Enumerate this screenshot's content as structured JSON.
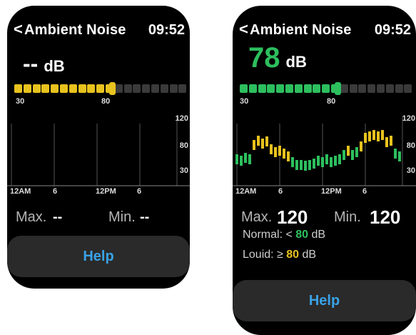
{
  "left": {
    "title": "Ambient Noise",
    "time": "09:52",
    "reading": "--",
    "unit": "dB",
    "bar_min": "30",
    "bar_mark": "80",
    "level_active": 0.57,
    "y_ticks": [
      "120",
      "80",
      "30"
    ],
    "x_ticks": [
      "12AM",
      "6",
      "12PM",
      "6"
    ],
    "max_label": "Max.",
    "max_value": "--",
    "min_label": "Min.",
    "min_value": "--",
    "help": "Help"
  },
  "right": {
    "title": "Ambient Noise",
    "time": "09:52",
    "reading": "78",
    "unit": "dB",
    "bar_min": "30",
    "bar_mark": "80",
    "level_active": 0.57,
    "y_ticks": [
      "120",
      "80",
      "30"
    ],
    "x_ticks": [
      "12AM",
      "6",
      "12PM",
      "6"
    ],
    "max_label": "Max.",
    "max_value": "120",
    "min_label": "Min.",
    "min_value": "120",
    "normal_label": "Normal:",
    "normal_sym": "<",
    "normal_val": "80",
    "loud_label": "Louid:",
    "loud_sym": "≥",
    "loud_val": "80",
    "legend_unit": "dB",
    "help": "Help"
  },
  "colors": {
    "green": "#2dbf5e",
    "yellow": "#e8c21e",
    "inactive": "#3a3a3a",
    "help": "#3aa2e6"
  }
}
